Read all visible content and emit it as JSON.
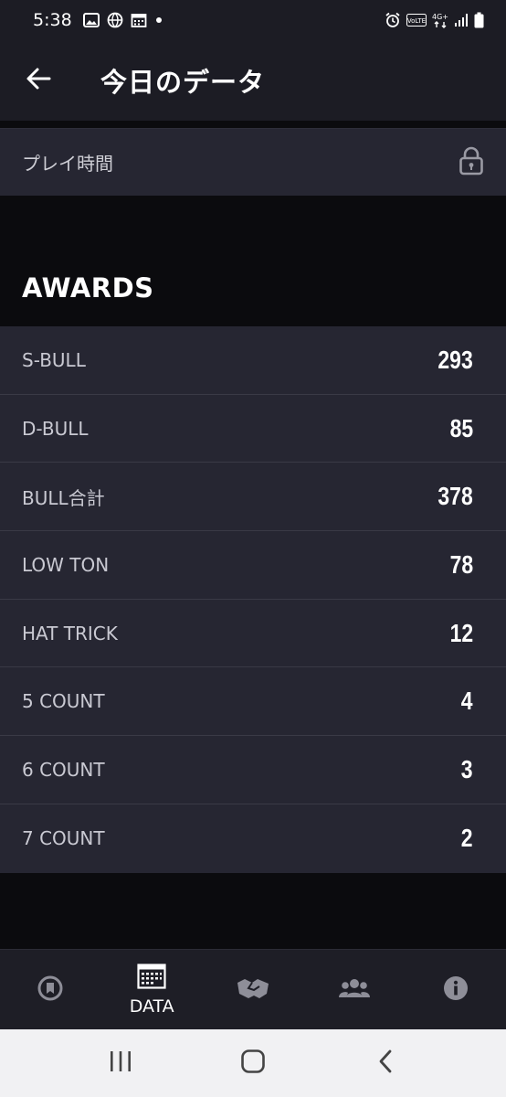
{
  "status_bar": {
    "time": "5:38",
    "left_icons": [
      "image-icon",
      "globe-icon",
      "calendar-icon",
      "dot-icon"
    ],
    "right_icons": [
      "alarm-icon",
      "volte-icon",
      "4g-icon",
      "signal-icon",
      "battery-icon"
    ],
    "network_label": "4G+",
    "volte_label": "VoLTE"
  },
  "header": {
    "back_icon": "arrow-left-icon",
    "title": "今日のデータ"
  },
  "play_time": {
    "label": "プレイ時間",
    "icon": "lock-icon"
  },
  "awards": {
    "heading": "AWARDS",
    "items": [
      {
        "label": "S-BULL",
        "value": "293"
      },
      {
        "label": "D-BULL",
        "value": "85"
      },
      {
        "label": "BULL合計",
        "value": "378"
      },
      {
        "label": "LOW TON",
        "value": "78"
      },
      {
        "label": "HAT TRICK",
        "value": "12"
      },
      {
        "label": "5 COUNT",
        "value": "4"
      },
      {
        "label": "6 COUNT",
        "value": "3"
      },
      {
        "label": "7 COUNT",
        "value": "2"
      }
    ]
  },
  "bottom_nav": {
    "items": [
      {
        "icon": "home-badge-icon",
        "label": ""
      },
      {
        "icon": "calendar-grid-icon",
        "label": "DATA"
      },
      {
        "icon": "handshake-icon",
        "label": ""
      },
      {
        "icon": "group-icon",
        "label": ""
      },
      {
        "icon": "info-icon",
        "label": ""
      }
    ],
    "active_index": 1
  },
  "system_nav": {
    "items": [
      "recent-apps-icon",
      "home-icon",
      "back-icon"
    ]
  },
  "colors": {
    "background": "#0b0b0e",
    "panel": "#262632",
    "bar": "#1c1c24",
    "divider": "#3a3a46",
    "text_primary": "#ffffff",
    "text_secondary": "#c9c9d2"
  }
}
